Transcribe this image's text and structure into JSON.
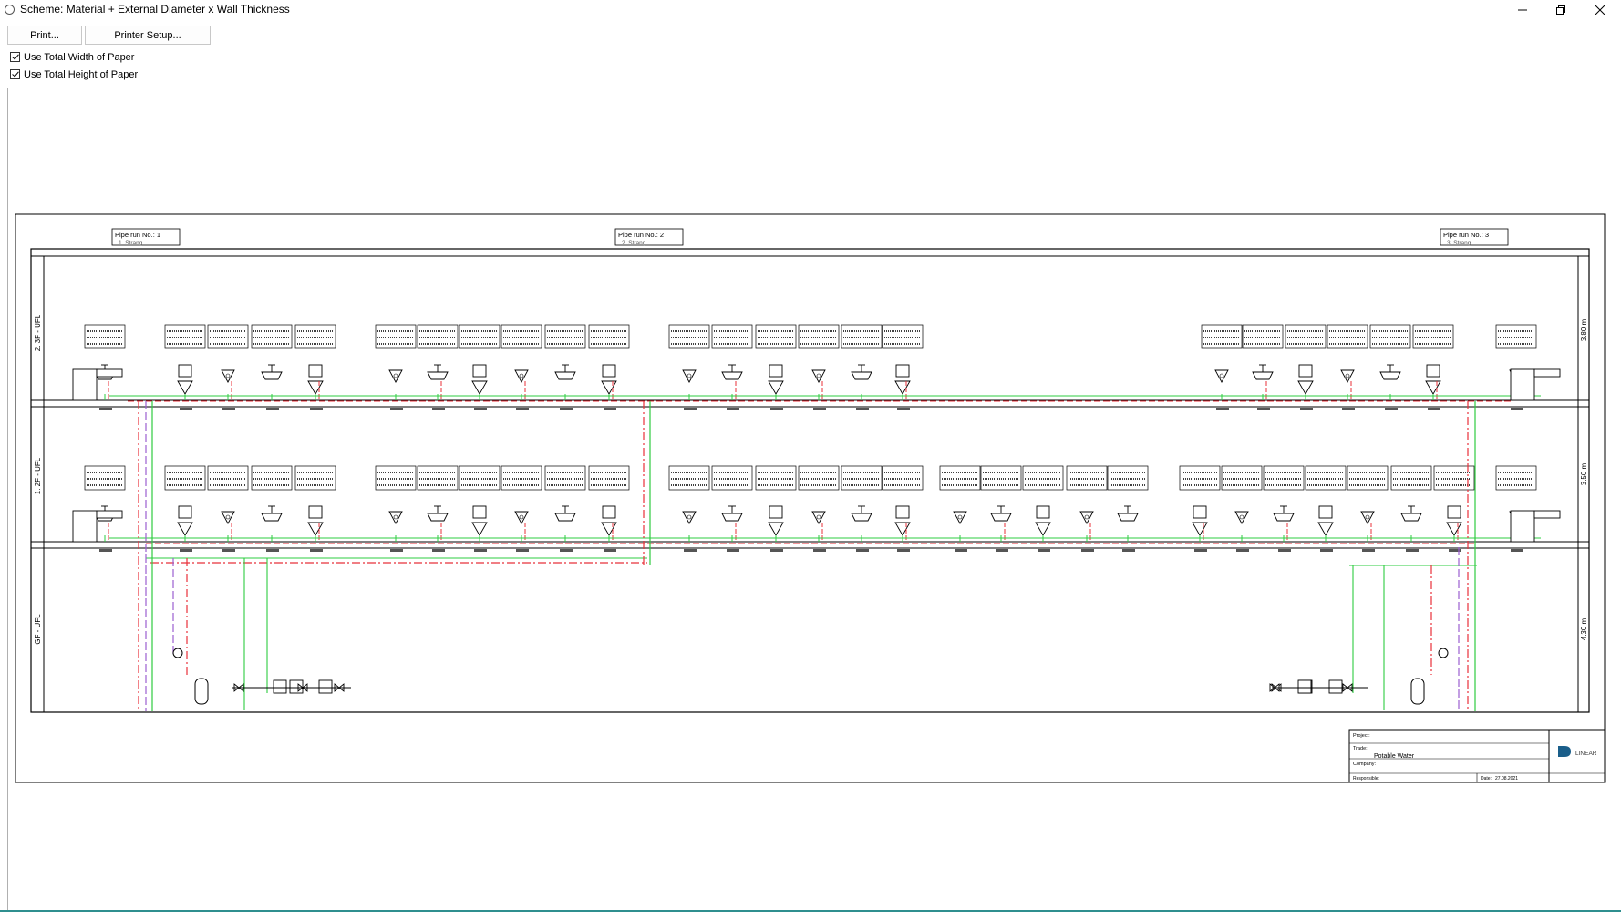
{
  "window": {
    "title": "Scheme: Material + External Diameter x Wall Thickness"
  },
  "toolbar": {
    "print_label": "Print...",
    "printer_setup_label": "Printer Setup..."
  },
  "options": {
    "use_total_width": {
      "label": "Use Total Width of Paper",
      "checked": true
    },
    "use_total_height": {
      "label": "Use Total Height of Paper",
      "checked": true
    }
  },
  "drawing": {
    "pipe_runs": [
      {
        "label": "Pipe run No.: 1",
        "sub": "1. Strang"
      },
      {
        "label": "Pipe run No.: 2",
        "sub": "2. Strang"
      },
      {
        "label": "Pipe run No.: 3",
        "sub": "3. Strang"
      }
    ],
    "floors": [
      {
        "label": "2. 3F - UFL",
        "height": "3.80 m"
      },
      {
        "label": "1. 2F - UFL",
        "height": "3.50 m"
      },
      {
        "label": "GF - UFL",
        "height": "4.30 m"
      }
    ],
    "title_block": {
      "project_label": "Project:",
      "trade_label": "Trade:",
      "trade_value": "Potable Water",
      "company_label": "Company:",
      "responsible_label": "Responsible:",
      "date_label": "Date:",
      "date_value": "27.08.2021",
      "logo_text": "LINEAR"
    },
    "colors": {
      "cold_water": "#2ecc40",
      "hot_water": "#e8303a",
      "circulation": "#9b5fd0",
      "frame": "#000000"
    }
  }
}
